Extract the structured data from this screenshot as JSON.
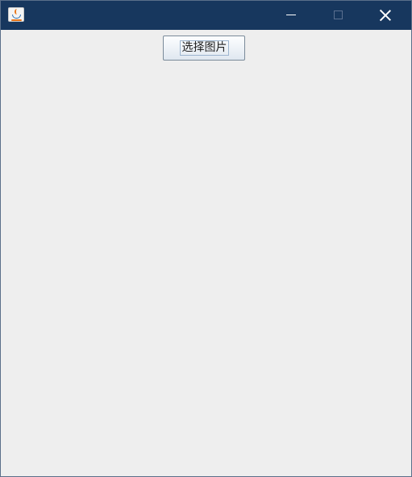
{
  "window": {
    "title": "",
    "app_icon": "java-coffee-cup-icon",
    "controls": {
      "minimize_icon": "minimize-icon",
      "maximize_icon": "maximize-icon",
      "close_icon": "close-icon"
    }
  },
  "content": {
    "choose_image_button_label": "选择图片"
  },
  "colors": {
    "titlebar": "#17375e",
    "background": "#eeeeee"
  }
}
